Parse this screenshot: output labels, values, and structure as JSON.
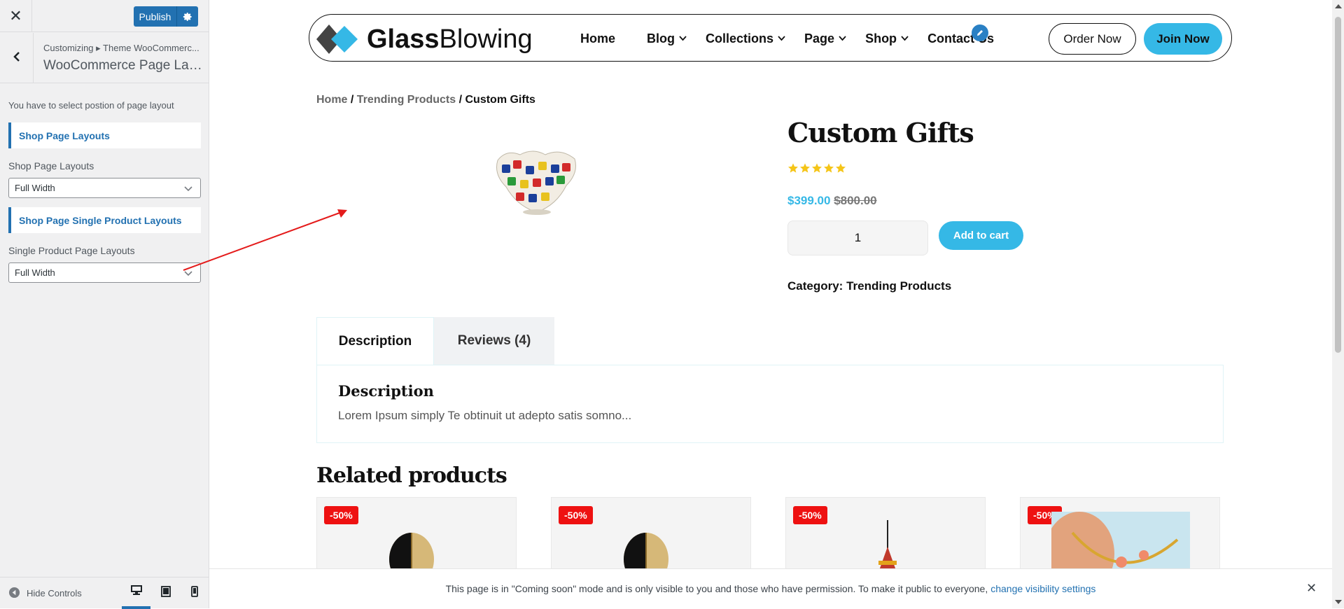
{
  "customizer": {
    "close_icon": "close-icon",
    "publish_label": "Publish",
    "breadcrumb": "Customizing ▸ Theme WooCommerc...",
    "section_title": "WooCommerce Page Lay...",
    "description": "You have to select postion of page layout",
    "shop_heading": "Shop Page Layouts",
    "shop_label": "Shop Page Layouts",
    "shop_value": "Full Width",
    "single_heading": "Shop Page Single Product Layouts",
    "single_label": "Single Product Page Layouts",
    "single_value": "Full Width",
    "hide_controls": "Hide Controls",
    "accent_color": "#2271b1"
  },
  "site": {
    "logo_bold": "Glass",
    "logo_light": "Blowing",
    "nav": [
      "Home",
      "Blog",
      "Collections",
      "Page",
      "Shop",
      "Contact Us"
    ],
    "order_now": "Order Now",
    "join_now": "Join Now",
    "accent_color": "#35b8e6"
  },
  "product": {
    "breadcrumb": {
      "home": "Home",
      "sep1": " / ",
      "trending": "Trending Products",
      "sep2": " / ",
      "current": "Custom Gifts"
    },
    "title": "Custom Gifts",
    "rating": 5,
    "sale_price": "$399.00",
    "regular_price": "$800.00",
    "quantity": "1",
    "add_to_cart": "Add to cart",
    "category": "Category: Trending Products",
    "tabs": [
      "Description",
      "Reviews (4)"
    ],
    "description_heading": "Description",
    "description_text": "Lorem Ipsum simply Te obtinuit ut adepto satis somno..."
  },
  "related": {
    "title": "Related products",
    "badges": [
      "-50%",
      "-50%",
      "-50%",
      "-50%"
    ]
  },
  "notice": {
    "text": "This page is in \"Coming soon\" mode and is only visible to you and those who have permission. To make it public to everyone,",
    "link": "change visibility settings"
  }
}
